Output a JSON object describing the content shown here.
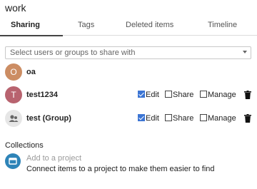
{
  "header": {
    "title": "work"
  },
  "tabs": [
    {
      "label": "Sharing",
      "active": true
    },
    {
      "label": "Tags",
      "active": false
    },
    {
      "label": "Deleted items",
      "active": false
    },
    {
      "label": "Timeline",
      "active": false
    }
  ],
  "share_select": {
    "placeholder": "Select users or groups to share with"
  },
  "users": [
    {
      "initial": "O",
      "name": "oa",
      "avatar_color": "#cc8d63"
    },
    {
      "initial": "T",
      "name": "test1234",
      "avatar_color": "#b8636f",
      "edit": true,
      "share": false,
      "manage": false
    },
    {
      "initial": "",
      "name": "test (Group)",
      "avatar_icon": "group-icon",
      "edit": true,
      "share": false,
      "manage": false
    }
  ],
  "perm_labels": {
    "edit": "Edit",
    "share": "Share",
    "manage": "Manage"
  },
  "collections": {
    "label": "Collections",
    "add_link": "Add to a project",
    "description": "Connect items to a project to make them easier to find"
  },
  "colors": {
    "accent_blue": "#3c75d4",
    "project_icon": "#2e84b8"
  }
}
